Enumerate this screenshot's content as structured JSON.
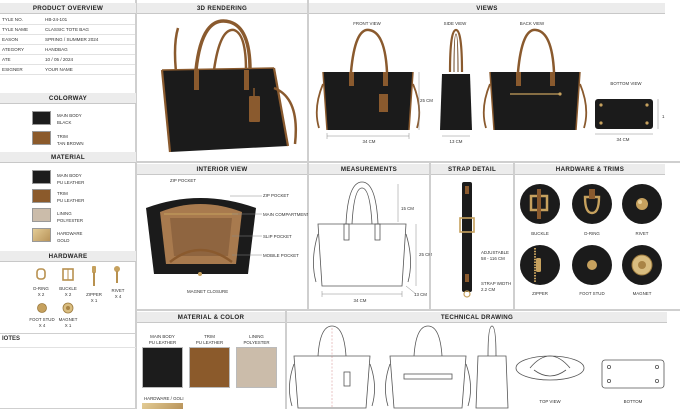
{
  "overview": {
    "title": "PRODUCT OVERVIEW",
    "rows": [
      {
        "k": "TYLE NO.",
        "v": "HB-24-101"
      },
      {
        "k": "TYLE NAME",
        "v": "CLASSIC TOTE BAG"
      },
      {
        "k": "EASON",
        "v": "SPRING / SUMMER 2024"
      },
      {
        "k": "ATEGORY",
        "v": "HANDBAG"
      },
      {
        "k": "ATE",
        "v": "10 / 05 / 2024"
      },
      {
        "k": "ESIGNER",
        "v": "YOUR NAME"
      }
    ]
  },
  "colorway": {
    "title": "COLORWAY",
    "items": [
      {
        "l1": "MAIN BODY",
        "l2": "BLACK",
        "color": "#1c1c1c"
      },
      {
        "l1": "TRIM",
        "l2": "TAN BROWN",
        "color": "#8b5a2b"
      }
    ]
  },
  "material": {
    "title": "MATERIAL",
    "items": [
      {
        "l1": "MAIN BODY",
        "l2": "PU LEATHER",
        "color": "#1c1c1c"
      },
      {
        "l1": "TRIM",
        "l2": "PU LEATHER",
        "color": "#8b5a2b"
      },
      {
        "l1": "LINING",
        "l2": "POLYESTER",
        "color": "#cbbcaa"
      },
      {
        "l1": "HARDWARE",
        "l2": "GOLD",
        "color": "#c9a86b"
      }
    ]
  },
  "hardware_left": {
    "title": "HARDWARE",
    "items": [
      {
        "l1": "D-RING",
        "l2": "X 2"
      },
      {
        "l1": "BUCKLE",
        "l2": "X 2"
      },
      {
        "l1": "ZIPPER",
        "l2": "X 1"
      },
      {
        "l1": "RIVET",
        "l2": "X 4"
      },
      {
        "l1": "FOOT STUD",
        "l2": "X 4"
      },
      {
        "l1": "MAGNET",
        "l2": "X 1"
      }
    ]
  },
  "notes": {
    "title": "IOTES"
  },
  "rendering": {
    "title": "3D RENDERING"
  },
  "views": {
    "title": "VIEWS",
    "front": "FRONT VIEW",
    "side": "SIDE VIEW",
    "back": "BACK VIEW",
    "bottom": "BOTTOM VIEW",
    "dim_height": "25 CM",
    "dim_width": "34 CM",
    "dim_depth": "13 CM",
    "dim_bottom_w": "34 CM",
    "dim_bottom_d": "1"
  },
  "interior": {
    "title": "INTERIOR VIEW",
    "zip_pocket_left": "ZIP POCKET",
    "zip_pocket_right": "ZIP POCKET",
    "main_compartment": "MAIN COMPARTMENT",
    "slip_pocket": "SLIP POCKET",
    "mobile_pocket": "MOBILE POCKET",
    "magnet_closure": "MAGNET CLOSURE"
  },
  "measurements": {
    "title": "MEASUREMENTS",
    "handle_drop": "15 CM",
    "height": "25 CM",
    "width": "34 CM",
    "depth": "13 CM"
  },
  "strap": {
    "title": "STRAP DETAIL",
    "adjustable_l1": "ADJUSTABLE",
    "adjustable_l2": "58 - 116 CM",
    "width_l1": "STRAP WIDTH",
    "width_l2": "2.2 CM"
  },
  "hardware_trims": {
    "title": "HARDWARE & TRIMS",
    "items": [
      "BUCKLE",
      "D-RING",
      "RIVET",
      "ZIPPER",
      "FOOT STUD",
      "MAGNET"
    ]
  },
  "material_color": {
    "title": "MATERIAL & COLOR",
    "items": [
      {
        "l1": "MAIN BODY",
        "l2": "PU LEATHER",
        "color": "#1c1c1c"
      },
      {
        "l1": "TRIM",
        "l2": "PU LEATHER",
        "color": "#8b5a2b"
      },
      {
        "l1": "LINING",
        "l2": "POLYESTER",
        "color": "#cbbcaa"
      }
    ],
    "hardware_label": "HARDWARE / GOLI"
  },
  "technical": {
    "title": "TECHNICAL DRAWING",
    "top_view": "TOP VIEW",
    "bottom": "BOTTOM"
  }
}
